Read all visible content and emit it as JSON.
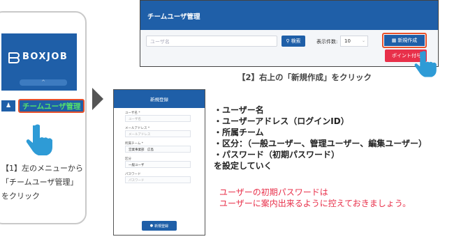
{
  "left_panel": {
    "logo_text": "BOXJOB",
    "collapse_glyph": "^",
    "menu_icon": "users-icon",
    "menu_item_label": "チームユーザ管理",
    "step_lines": [
      "【1】左のメニューから",
      "「チームユーザ管理」",
      "をクリック"
    ]
  },
  "top_screen": {
    "title": "チームユーザ管理",
    "search_placeholder": "ユーザ名",
    "search_button": "検索",
    "count_label": "表示件数:",
    "count_value": "10",
    "new_button": "新規作成",
    "point_button": "ポイント付与"
  },
  "step2_caption": "【2】右上の「新規作成」をクリック",
  "form_screen": {
    "title": "新規登録",
    "fields": [
      {
        "label": "ユーザ名 *",
        "value": "ユーザ名",
        "filled": false
      },
      {
        "label": "メールアドレス *",
        "value": "メールアドレス",
        "filled": false
      },
      {
        "label": "所属チーム *",
        "value": "営業事業部　広島",
        "filled": true
      },
      {
        "label": "区分",
        "value": "一般ユーザ",
        "filled": true
      },
      {
        "label": "パスワード",
        "value": "パスワード",
        "filled": false
      }
    ],
    "submit_label": "新規登録"
  },
  "bullets": [
    "・ユーザー名",
    "・ユーザーアドレス（ログインID）",
    "・所属チーム",
    "・区分：（一般ユーザー、管理ユーザー、編集ユーザー）",
    "・パスワード（初期パスワード）",
    "を設定していく"
  ],
  "note_lines": [
    "ユーザーの初期パスワードは",
    "ユーザーに案内出来るように控えておきましょう。"
  ],
  "colors": {
    "brand_blue": "#1f5fa8",
    "highlight": "#e8502a",
    "accent_red": "#e8304a",
    "menu_green": "#56e06a",
    "hand_blue": "#2e9bd6"
  }
}
